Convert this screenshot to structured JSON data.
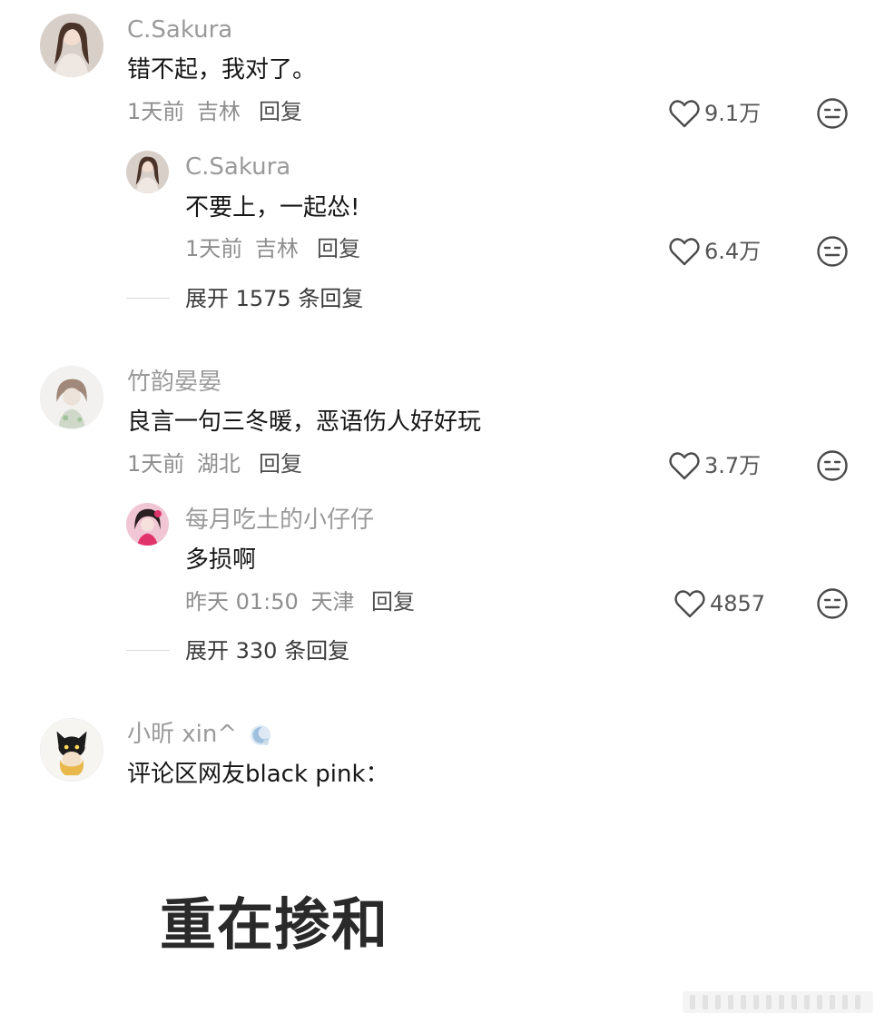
{
  "comments": [
    {
      "user": "C.Sakura",
      "text": "错不起，我对了。",
      "time": "1天前",
      "location": "吉林",
      "reply_label": "回复",
      "likes": "9.1万",
      "replies": [
        {
          "user": "C.Sakura",
          "text": "不要上，一起怂!",
          "time": "1天前",
          "location": "吉林",
          "reply_label": "回复",
          "likes": "6.4万"
        }
      ],
      "expand_label": "展开 1575 条回复"
    },
    {
      "user": "竹韵晏晏",
      "text": "良言一句三冬暖，恶语伤人好好玩",
      "time": "1天前",
      "location": "湖北",
      "reply_label": "回复",
      "likes": "3.7万",
      "replies": [
        {
          "user": "每月吃土的小仔仔",
          "text": "多损啊",
          "time": "昨天 01:50",
          "location": "天津",
          "reply_label": "回复",
          "likes": "4857"
        }
      ],
      "expand_label": "展开 330 条回复"
    },
    {
      "user": "小昕 xin^",
      "text": "评论区网友black  pink：",
      "sticker_text": "重在掺和"
    }
  ],
  "colors": {
    "name": "#9a9a9a",
    "text": "#161616",
    "meta": "#8e8e8e",
    "icon": "#4a4a4a"
  },
  "icons": {
    "like": "heart-outline-icon",
    "dislike": "neutral-face-icon",
    "badge": "moon-badge-icon"
  }
}
